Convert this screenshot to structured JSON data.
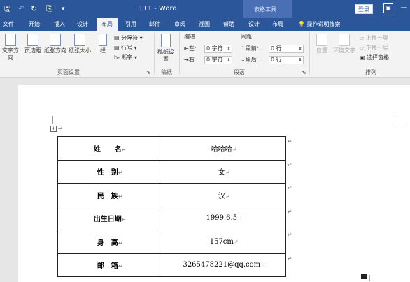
{
  "titlebar": {
    "save_glyph": "🖫",
    "undo_glyph": "↶",
    "redo_glyph": "↻",
    "format_glyph": "⎘",
    "customize_glyph": "▾",
    "title": "111 - Word",
    "context_group": "表格工具",
    "login": "登录",
    "restore_glyph": "▣",
    "minimize_glyph": "—"
  },
  "tabs": [
    "文件",
    "开始",
    "插入",
    "设计",
    "布局",
    "引用",
    "邮件",
    "审阅",
    "视图",
    "帮助",
    "设计",
    "布局"
  ],
  "active_tab": "布局",
  "tell_me": "操作说明搜索",
  "ribbon": {
    "page_setup": {
      "text_direction": "文字方向",
      "margins": "页边距",
      "orientation": "纸张方向",
      "size": "纸张大小",
      "columns": "栏",
      "breaks": "分隔符",
      "line_numbers": "行号",
      "hyphenation": "断字",
      "label": "页面设置"
    },
    "draft": {
      "button": "稿纸设置",
      "label": "稿纸"
    },
    "paragraph": {
      "indent_title": "缩进",
      "spacing_title": "间距",
      "left_label": "左:",
      "left_value": "0 字符",
      "right_label": "右:",
      "right_value": "0 字符",
      "before_label": "段前:",
      "before_value": "0 行",
      "after_label": "段后:",
      "after_value": "0 行",
      "label": "段落"
    },
    "arrange": {
      "position": "位置",
      "wrap_text": "环绕文字",
      "bring_forward": "上移一层",
      "send_backward": "下移一层",
      "selection_pane": "选择窗格",
      "label": "排列"
    }
  },
  "document": {
    "table_handle": "+",
    "rows": [
      {
        "label": "姓　　名",
        "value": "哈哈哈"
      },
      {
        "label": "性　别",
        "value": "女"
      },
      {
        "label": "民　族",
        "value": "汉"
      },
      {
        "label": "出生日期",
        "value": "1999.6.5"
      },
      {
        "label": "身　高",
        "value": "157cm"
      },
      {
        "label": "邮　箱",
        "value": "3265478221@qq.com"
      }
    ],
    "pilcrow": "↵"
  }
}
